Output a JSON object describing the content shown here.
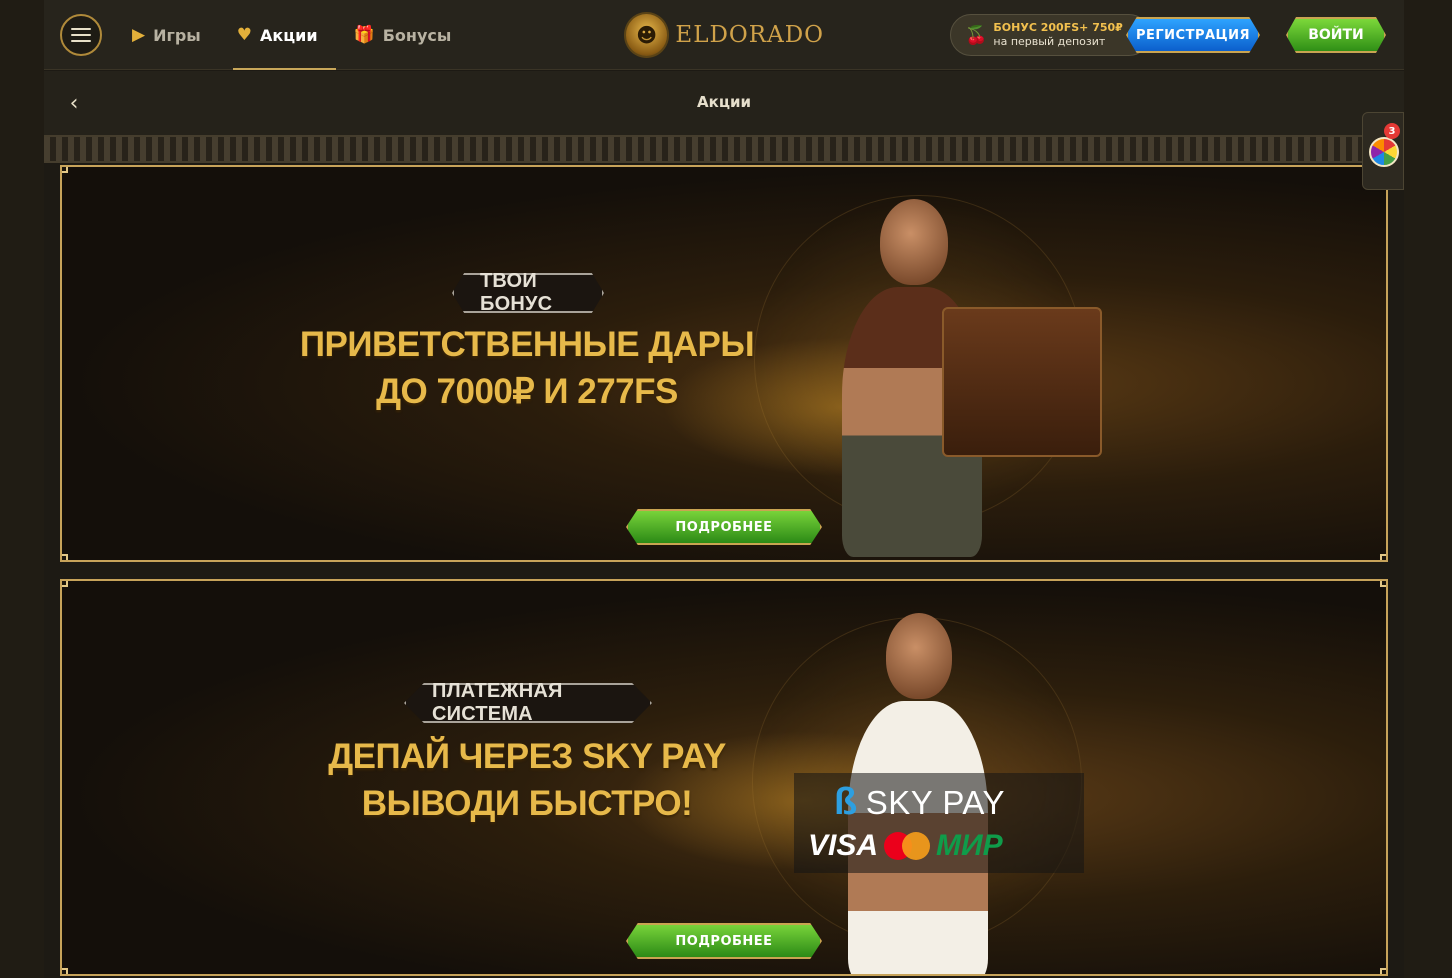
{
  "header": {
    "nav": [
      {
        "label": "Игры",
        "icon": "play-icon"
      },
      {
        "label": "Акции",
        "icon": "heart-icon",
        "active": true
      },
      {
        "label": "Бонусы",
        "icon": "gift-icon"
      }
    ],
    "logo_text": "ELDORADO",
    "bonus": {
      "line1": "БОНУС 200FS+ 750₽",
      "line2": "на первый депозит"
    },
    "register_label": "РЕГИСТРАЦИЯ",
    "login_label": "ВОЙТИ"
  },
  "titlebar": {
    "title": "Акции"
  },
  "widget": {
    "badge": "3"
  },
  "banners": [
    {
      "tag": "ТВОЙ БОНУС",
      "headline_1": "ПРИВЕТСТВЕННЫЕ ДАРЫ",
      "headline_2": "ДО 7000₽ И 277FS",
      "button": "ПОДРОБНЕЕ"
    },
    {
      "tag": "ПЛАТЕЖНАЯ СИСТЕМА",
      "headline_1": "ДЕПАЙ ЧЕРЕЗ SKY PAY",
      "headline_2": "ВЫВОДИ БЫСТРО!",
      "button": "ПОДРОБНЕЕ",
      "skypay": "SKY PAY",
      "visa": "VISA",
      "mir": "МИР"
    }
  ],
  "colors": {
    "accent_gold": "#c7a35a",
    "headline": "#e7b94a",
    "green_button": "#2c8a16",
    "blue_button": "#0b5fcc"
  }
}
